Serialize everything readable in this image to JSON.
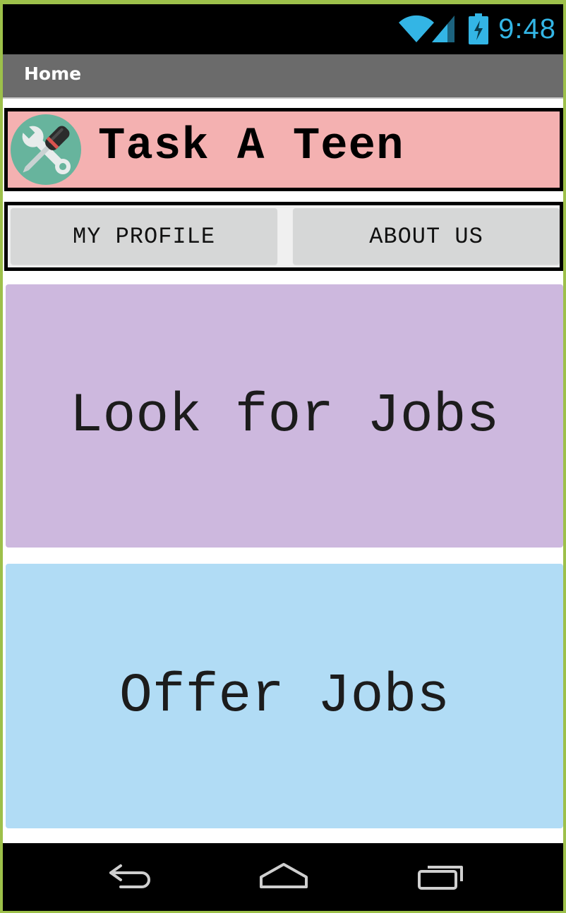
{
  "status_bar": {
    "time": "9:48",
    "icons": [
      "wifi-icon",
      "signal-icon",
      "battery-icon"
    ],
    "icon_color": "#33b5e5"
  },
  "action_bar": {
    "title": "Home"
  },
  "header": {
    "app_name": "Task A Teen",
    "logo_icon": "screwdriver-wrench-icon",
    "background": "#f4b1b1"
  },
  "nav_buttons": {
    "profile_label": "MY PROFILE",
    "about_label": "ABOUT US"
  },
  "main": {
    "look_label": "Look for Jobs",
    "look_color": "#cdb8de",
    "offer_label": "Offer Jobs",
    "offer_color": "#b1dcf5"
  },
  "system_nav": {
    "icons": [
      "back-icon",
      "home-icon",
      "recent-apps-icon"
    ]
  }
}
